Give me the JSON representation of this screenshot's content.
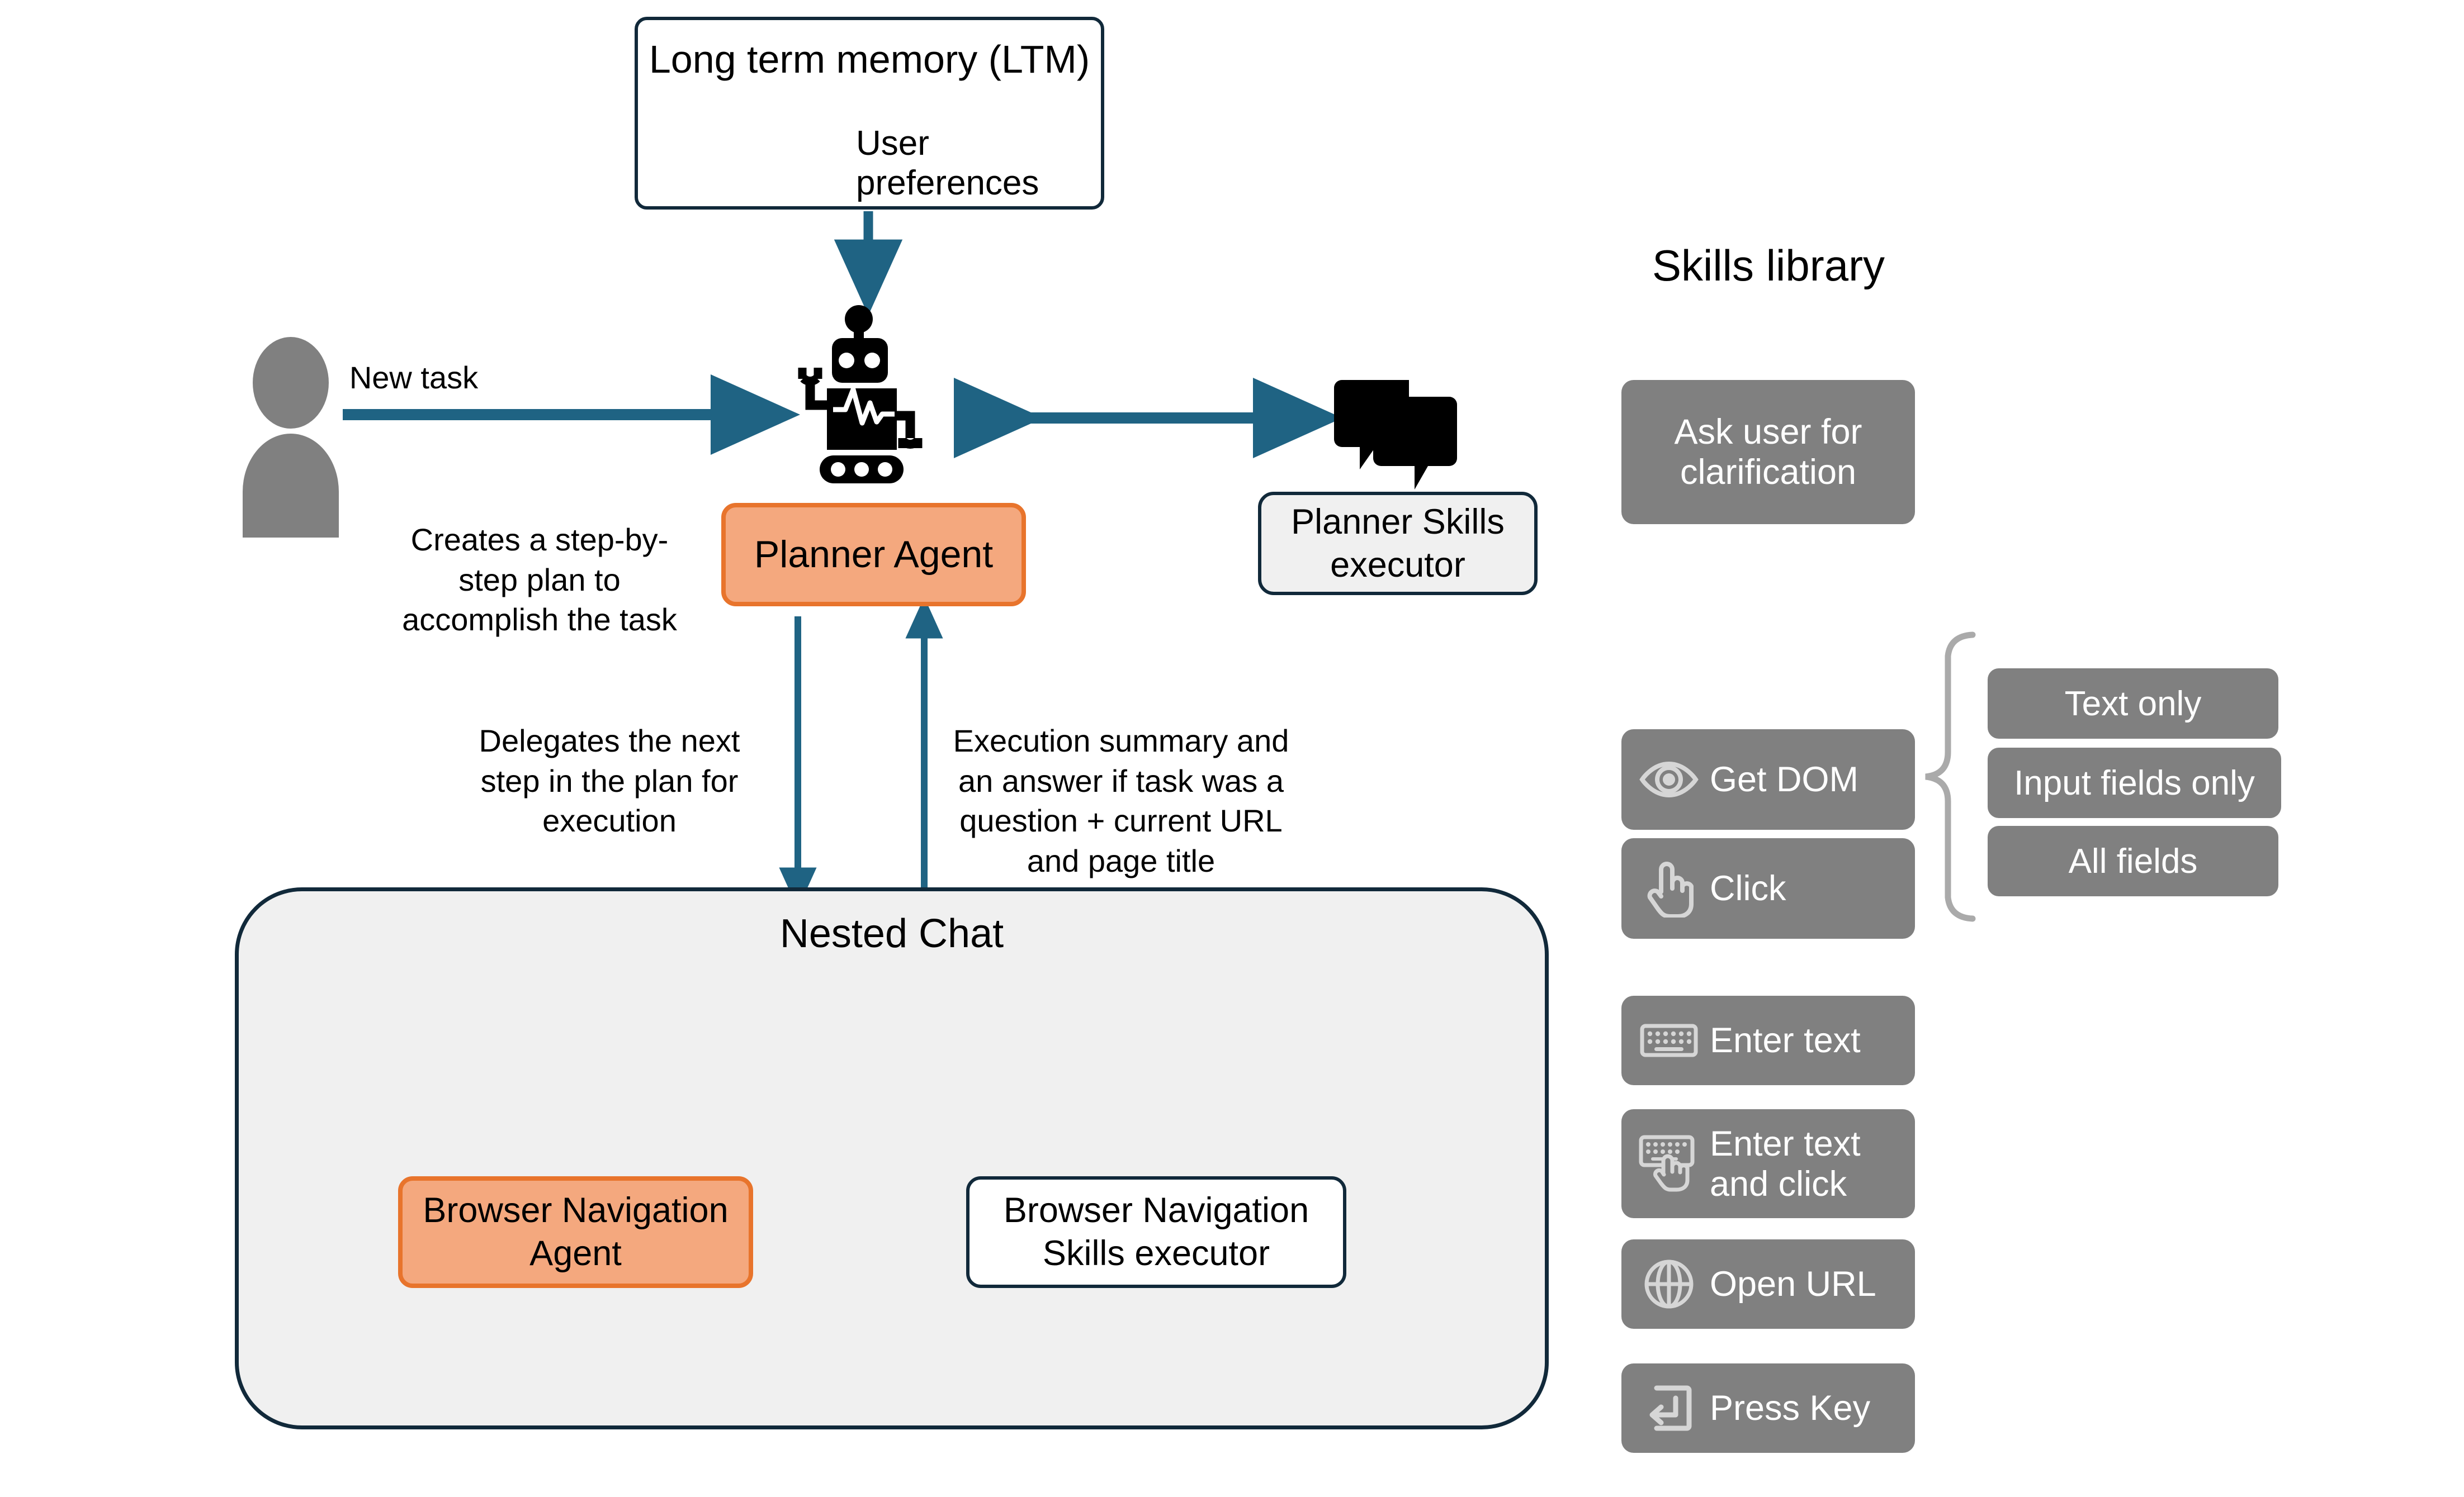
{
  "diagram": {
    "title_ltm": "Long term memory (LTM)",
    "ltm_item": "User preferences",
    "new_task_label": "New task",
    "planner_agent": "Planner Agent",
    "planner_note": "Creates a step-by-step plan to accomplish the task",
    "planner_skills_executor": "Planner Skills executor",
    "delegate_note": "Delegates the next step in the plan for execution",
    "summary_note": "Execution summary and an answer if task was a question + current URL and page title",
    "nested_chat_title": "Nested Chat",
    "browser_navigation_agent": "Browser Navigation Agent",
    "browser_navigation_skills_executor": "Browser Navigation Skills executor"
  },
  "skills_library": {
    "title": "Skills library",
    "items": [
      {
        "label": "Ask user for clarification",
        "icon": "none"
      },
      {
        "label": "Get DOM",
        "icon": "eye-icon"
      },
      {
        "label": "Click",
        "icon": "pointer-hand-icon"
      },
      {
        "label": "Enter text",
        "icon": "keyboard-icon"
      },
      {
        "label": "Enter text and click",
        "icon": "keyboard-click-icon"
      },
      {
        "label": "Open URL",
        "icon": "globe-icon"
      },
      {
        "label": "Press Key",
        "icon": "enter-key-icon"
      }
    ],
    "dom_options": [
      "Text only",
      "Input fields only",
      "All fields"
    ]
  },
  "icons": {
    "user": "user-avatar-icon",
    "robot": "robot-icon",
    "chat": "chat-bubbles-icon",
    "book_gear": "book-gear-icon",
    "browser_robot": "browser-window-robot-icon",
    "browser_blank": "browser-window-icon"
  },
  "colors": {
    "accent_arrow": "#1F6383",
    "orange_fill": "#F4A87E",
    "orange_border": "#E8742C",
    "navy_border": "#11293A",
    "panel_gray": "#F0F0F0",
    "skill_gray": "#808080",
    "icon_gray": "#808080",
    "book_blue_dark": "#0E63C3",
    "book_blue_light": "#4D9BEE",
    "gear_cyan": "#36CCE8"
  }
}
